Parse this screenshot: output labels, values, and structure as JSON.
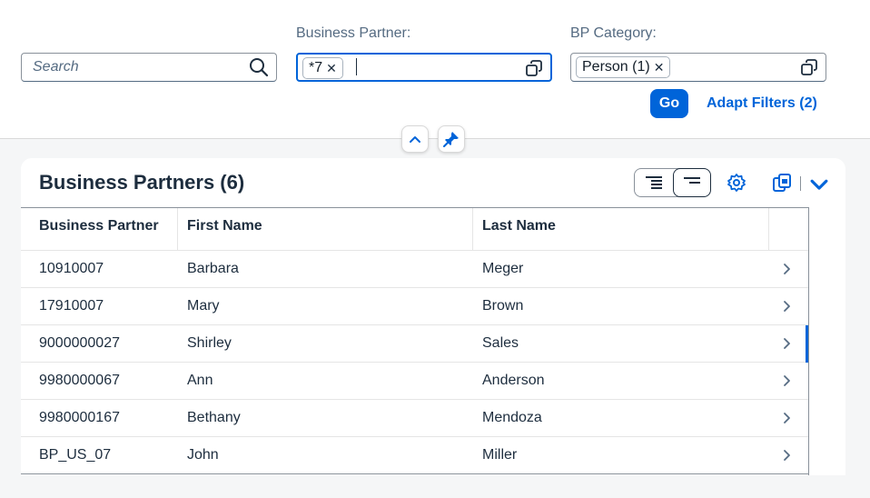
{
  "filterbar": {
    "search": {
      "placeholder": "Search"
    },
    "business_partner": {
      "label": "Business Partner:",
      "tokens": [
        "*7"
      ]
    },
    "bp_category": {
      "label": "BP Category:",
      "tokens": [
        "Person (1)"
      ]
    },
    "go_label": "Go",
    "adapt_filters_label": "Adapt Filters (2)"
  },
  "table": {
    "title": "Business Partners (6)",
    "columns": [
      "Business Partner",
      "First Name",
      "Last Name"
    ],
    "rows": [
      {
        "bp": "10910007",
        "first": "Barbara",
        "last": "Meger"
      },
      {
        "bp": "17910007",
        "first": "Mary",
        "last": "Brown"
      },
      {
        "bp": "9000000027",
        "first": "Shirley",
        "last": "Sales"
      },
      {
        "bp": "9980000067",
        "first": "Ann",
        "last": "Anderson"
      },
      {
        "bp": "9980000167",
        "first": "Bethany",
        "last": "Mendoza"
      },
      {
        "bp": "BP_US_07",
        "first": "John",
        "last": "Miller"
      }
    ]
  },
  "icons": [
    "search-icon",
    "value-help-icon",
    "collapse-icon",
    "pin-icon",
    "show-details-icon",
    "hide-details-icon",
    "settings-icon",
    "export-icon",
    "chevron-down-icon",
    "navigation-arrow-icon"
  ],
  "colors": {
    "accent": "#0064d9",
    "text": "#1d2d3e",
    "label": "#556b82",
    "background": "#f5f6f7"
  }
}
